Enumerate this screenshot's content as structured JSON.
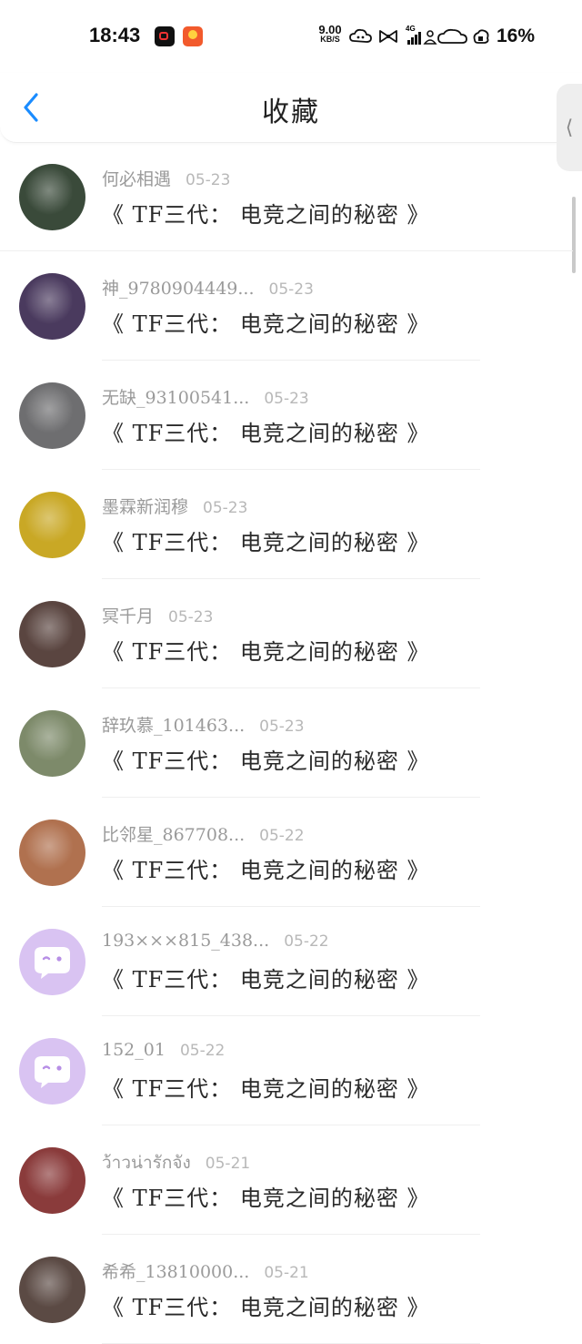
{
  "status_bar": {
    "time": "18:43",
    "net_speed_value": "9.00",
    "net_speed_unit": "KB/S",
    "network_type": "4G",
    "battery": "16%",
    "icons": [
      "video-app-icon",
      "shopping-app-icon",
      "bluetooth-cloud-icon",
      "bow-icon",
      "signal-icon",
      "wifi-icon",
      "cloud-icon",
      "battery-icon"
    ]
  },
  "nav": {
    "title": "收藏",
    "back_icon": "chevron-left-icon",
    "side_tab_glyph": "⟨"
  },
  "list": {
    "items": [
      {
        "user": "何必相遇",
        "date": "05-23",
        "title": "《 TF三代： 电竞之间的秘密 》",
        "avatar_color": "#3a4a3a"
      },
      {
        "user": "神_9780904449...",
        "date": "05-23",
        "title": "《 TF三代： 电竞之间的秘密 》",
        "avatar_color": "#4a3a5e"
      },
      {
        "user": "无缺_93100541...",
        "date": "05-23",
        "title": "《 TF三代： 电竞之间的秘密 》",
        "avatar_color": "#6e6e70"
      },
      {
        "user": "墨霖新润穆",
        "date": "05-23",
        "title": "《 TF三代： 电竞之间的秘密 》",
        "avatar_color": "#c9a825"
      },
      {
        "user": "冥千月",
        "date": "05-23",
        "title": "《 TF三代： 电竞之间的秘密 》",
        "avatar_color": "#5a4540"
      },
      {
        "user": "辞玖慕_101463...",
        "date": "05-23",
        "title": "《 TF三代： 电竞之间的秘密 》",
        "avatar_color": "#7d8a6a"
      },
      {
        "user": "比邻星_867708...",
        "date": "05-22",
        "title": "《 TF三代： 电竞之间的秘密 》",
        "avatar_color": "#b0714f"
      },
      {
        "user": "193×××815_438...",
        "date": "05-22",
        "title": "《 TF三代： 电竞之间的秘密 》",
        "avatar_color": "#d9c3f2",
        "default_avatar": true
      },
      {
        "user": "152_01",
        "date": "05-22",
        "title": "《 TF三代： 电竞之间的秘密 》",
        "avatar_color": "#d9c3f2",
        "default_avatar": true
      },
      {
        "user": "ว้าวน่ารักจัง",
        "date": "05-21",
        "title": "《 TF三代： 电竞之间的秘密 》",
        "avatar_color": "#8a3b3b"
      },
      {
        "user": "希希_13810000...",
        "date": "05-21",
        "title": "《 TF三代： 电竞之间的秘密 》",
        "avatar_color": "#5b4a44"
      }
    ]
  },
  "colors": {
    "accent": "#1a8cff",
    "title_text": "#2a2a2a",
    "muted_text": "#9a9a9a",
    "default_avatar_bg": "#d9c3f2"
  }
}
